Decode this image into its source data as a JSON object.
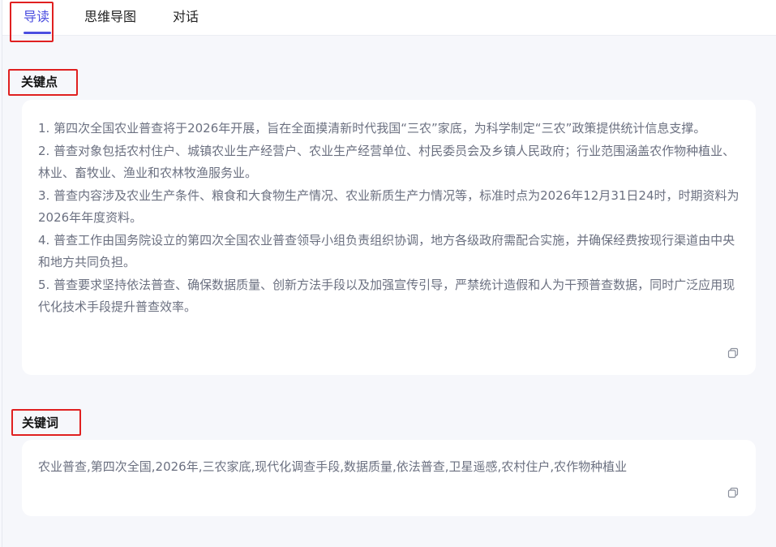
{
  "tabs": [
    {
      "label": "导读",
      "active": true
    },
    {
      "label": "思维导图",
      "active": false
    },
    {
      "label": "对话",
      "active": false
    }
  ],
  "key_points": {
    "title": "关键点",
    "items": [
      "1. 第四次全国农业普查将于2026年开展，旨在全面摸清新时代我国“三农”家底，为科学制定“三农”政策提供统计信息支撑。",
      "2. 普查对象包括农村住户、城镇农业生产经营户、农业生产经营单位、村民委员会及乡镇人民政府；行业范围涵盖农作物种植业、林业、畜牧业、渔业和农林牧渔服务业。",
      "3. 普查内容涉及农业生产条件、粮食和大食物生产情况、农业新质生产力情况等，标准时点为2026年12月31日24时，时期资料为2026年年度资料。",
      "4. 普查工作由国务院设立的第四次全国农业普查领导小组负责组织协调，地方各级政府需配合实施，并确保经费按现行渠道由中央和地方共同负担。",
      "5. 普查要求坚持依法普查、确保数据质量、创新方法手段以及加强宣传引导，严禁统计造假和人为干预普查数据，同时广泛应用现代化技术手段提升普查效率。"
    ]
  },
  "keywords": {
    "title": "关键词",
    "text": "农业普查,第四次全国,2026年,三农家底,现代化调查手段,数据质量,依法普查,卫星遥感,农村住户,农作物种植业"
  },
  "icons": {
    "copy": "copy-icon"
  },
  "colors": {
    "accent": "#4b4ee0",
    "annotation": "#e02020",
    "body_text": "#6b7080"
  }
}
